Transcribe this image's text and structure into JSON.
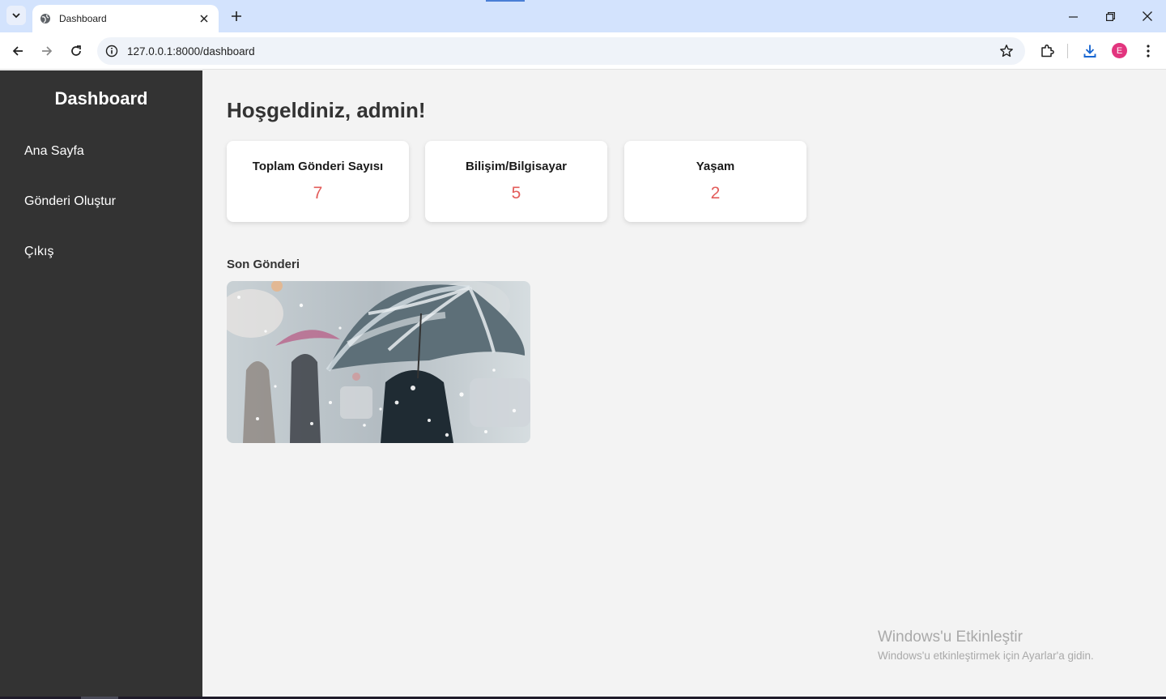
{
  "browser": {
    "tab_title": "Dashboard",
    "url": "127.0.0.1:8000/dashboard",
    "profile_initial": "E"
  },
  "sidebar": {
    "title": "Dashboard",
    "items": [
      {
        "label": "Ana Sayfa"
      },
      {
        "label": "Gönderi Oluştur"
      },
      {
        "label": "Çıkış"
      }
    ]
  },
  "main": {
    "welcome": "Hoşgeldiniz, admin!",
    "cards": [
      {
        "label": "Toplam Gönderi Sayısı",
        "value": "7"
      },
      {
        "label": "Bilişim/Bilgisayar",
        "value": "5"
      },
      {
        "label": "Yaşam",
        "value": "2"
      }
    ],
    "latest_post_label": "Son Gönderi"
  },
  "watermark": {
    "title": "Windows'u Etkinleştir",
    "subtitle": "Windows'u etkinleştirmek için Ayarlar'a gidin."
  },
  "colors": {
    "sidebar_bg": "#333333",
    "page_bg": "#f3f3f3",
    "card_value": "#e35d5b",
    "tabbar_bg": "#d3e3fd"
  },
  "icons": [
    "tab-search-icon",
    "globe-icon",
    "close-icon",
    "plus-icon",
    "minimize-icon",
    "restore-icon",
    "back-icon",
    "forward-icon",
    "reload-icon",
    "info-icon",
    "star-icon",
    "extensions-icon",
    "download-icon",
    "kebab-menu-icon"
  ]
}
